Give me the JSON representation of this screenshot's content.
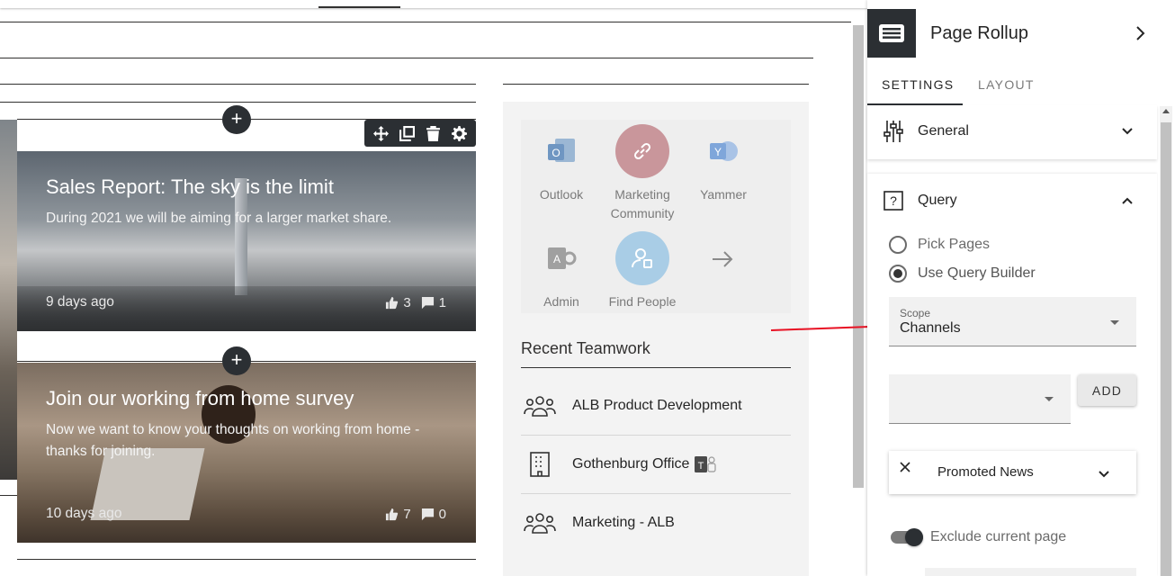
{
  "news": [
    {
      "title": "Sales Report: The sky is the limit",
      "description": "During 2021 we will be aiming for a larger market share.",
      "age": "9 days ago",
      "likes": "3",
      "comments": "1"
    },
    {
      "title": "Join our working from home survey",
      "description": "Now we want to know your thoughts on working from home - thanks for joining.",
      "age": "10 days ago",
      "likes": "7",
      "comments": "0"
    }
  ],
  "quick_links": [
    {
      "label": "Outlook",
      "icon": "outlook-icon"
    },
    {
      "label": "Marketing Community",
      "icon": "link-icon"
    },
    {
      "label": "Yammer",
      "icon": "yammer-icon"
    },
    {
      "label": "Admin",
      "icon": "admin-icon"
    },
    {
      "label": "Find People",
      "icon": "find-people-icon"
    }
  ],
  "teamwork": {
    "title": "Recent Teamwork",
    "items": [
      {
        "label": "ALB Product Development",
        "icon": "group-icon"
      },
      {
        "label": "Gothenburg Office",
        "icon": "building-icon"
      },
      {
        "label": "Marketing - ALB",
        "icon": "group-icon"
      }
    ]
  },
  "pane": {
    "title": "Page Rollup",
    "tabs": [
      "SETTINGS",
      "LAYOUT"
    ],
    "general_label": "General",
    "query_label": "Query",
    "radio_pick": "Pick Pages",
    "radio_builder": "Use Query Builder",
    "scope_label": "Scope",
    "scope_value": "Channels",
    "add_label": "ADD",
    "filter_label": "Promoted News",
    "toggle_label": "Exclude current page"
  },
  "colors": {
    "accent_dark": "#2b2f33",
    "arrow": "#e81123",
    "marketing_circle": "#c9969b",
    "people_circle": "#a9cde6"
  }
}
